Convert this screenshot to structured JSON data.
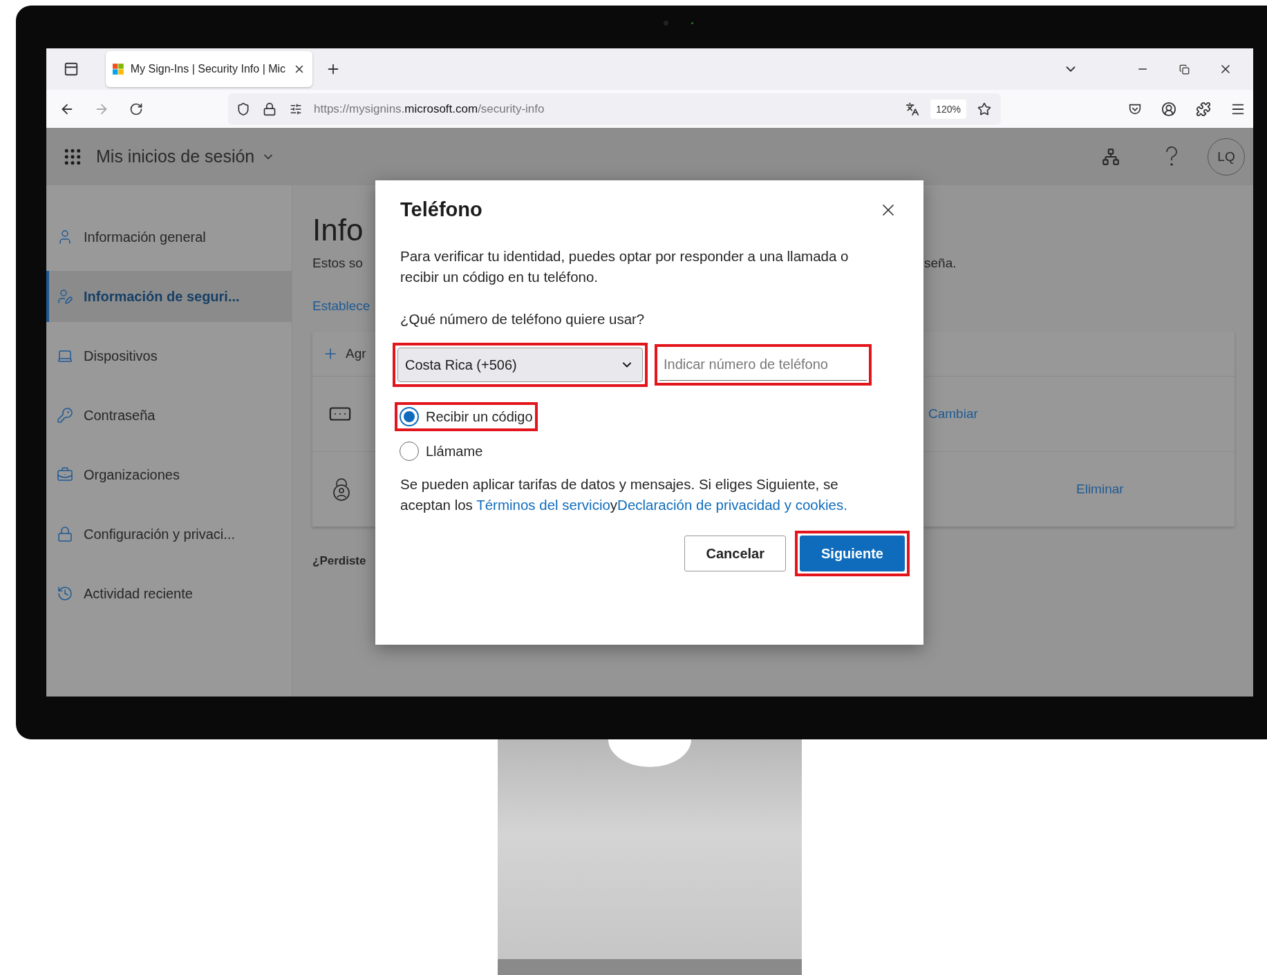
{
  "browser": {
    "tab": {
      "title": "My Sign-Ins | Security Info | Mic",
      "selected": true
    },
    "url": "https://mysignins.**microsoft.com**/security-info",
    "zoom": "120%"
  },
  "header": {
    "app_title": "Mis inicios de sesión",
    "avatar": "LQ"
  },
  "sidebar": {
    "items": [
      {
        "kind": "user",
        "label": "Información general",
        "selected": false
      },
      {
        "kind": "security",
        "label": "Información de seguri...",
        "selected": true
      },
      {
        "kind": "devices",
        "label": "Dispositivos",
        "selected": false
      },
      {
        "kind": "password",
        "label": "Contraseña",
        "selected": false
      },
      {
        "kind": "orgs",
        "label": "Organizaciones",
        "selected": false
      },
      {
        "kind": "privacy",
        "label": "Configuración y privaci...",
        "selected": false
      },
      {
        "kind": "activity",
        "label": "Actividad reciente",
        "selected": false
      }
    ]
  },
  "page": {
    "heading": "Info",
    "intro_left": "Estos so",
    "intro_right": "seña.",
    "link": "Establece",
    "methods": [
      {
        "kind": "add",
        "label": "Agr"
      },
      {
        "kind": "change",
        "action": "Cambiar"
      },
      {
        "kind": "remove",
        "action": "Eliminar"
      }
    ],
    "lost_device": "¿Perdiste"
  },
  "dialog": {
    "title": "Teléfono",
    "description": "Para verificar tu identidad, puedes optar por responder a una llamada o recibir un código en tu teléfono.",
    "question": "¿Qué número de teléfono quiere usar?",
    "country": {
      "value": "Costa Rica (+506)",
      "highlighted": true
    },
    "phone": {
      "placeholder": "Indicar número de teléfono",
      "highlighted": true
    },
    "options": [
      {
        "label": "Recibir un código",
        "selected": true,
        "highlighted": true
      },
      {
        "label": "Llámame",
        "selected": false,
        "highlighted": false
      }
    ],
    "terms": {
      "text": "Se pueden aplicar tarifas de datos y mensajes. Si eliges Siguiente, se aceptan los ",
      "link_terms": "Términos del servicio",
      "joiner": "y",
      "link_privacy": "Declaración de privacidad y cookies."
    },
    "buttons": [
      {
        "kind": "secondary",
        "label": "Cancelar",
        "highlighted": false
      },
      {
        "kind": "primary",
        "label": "Siguiente",
        "highlighted": true
      }
    ]
  }
}
